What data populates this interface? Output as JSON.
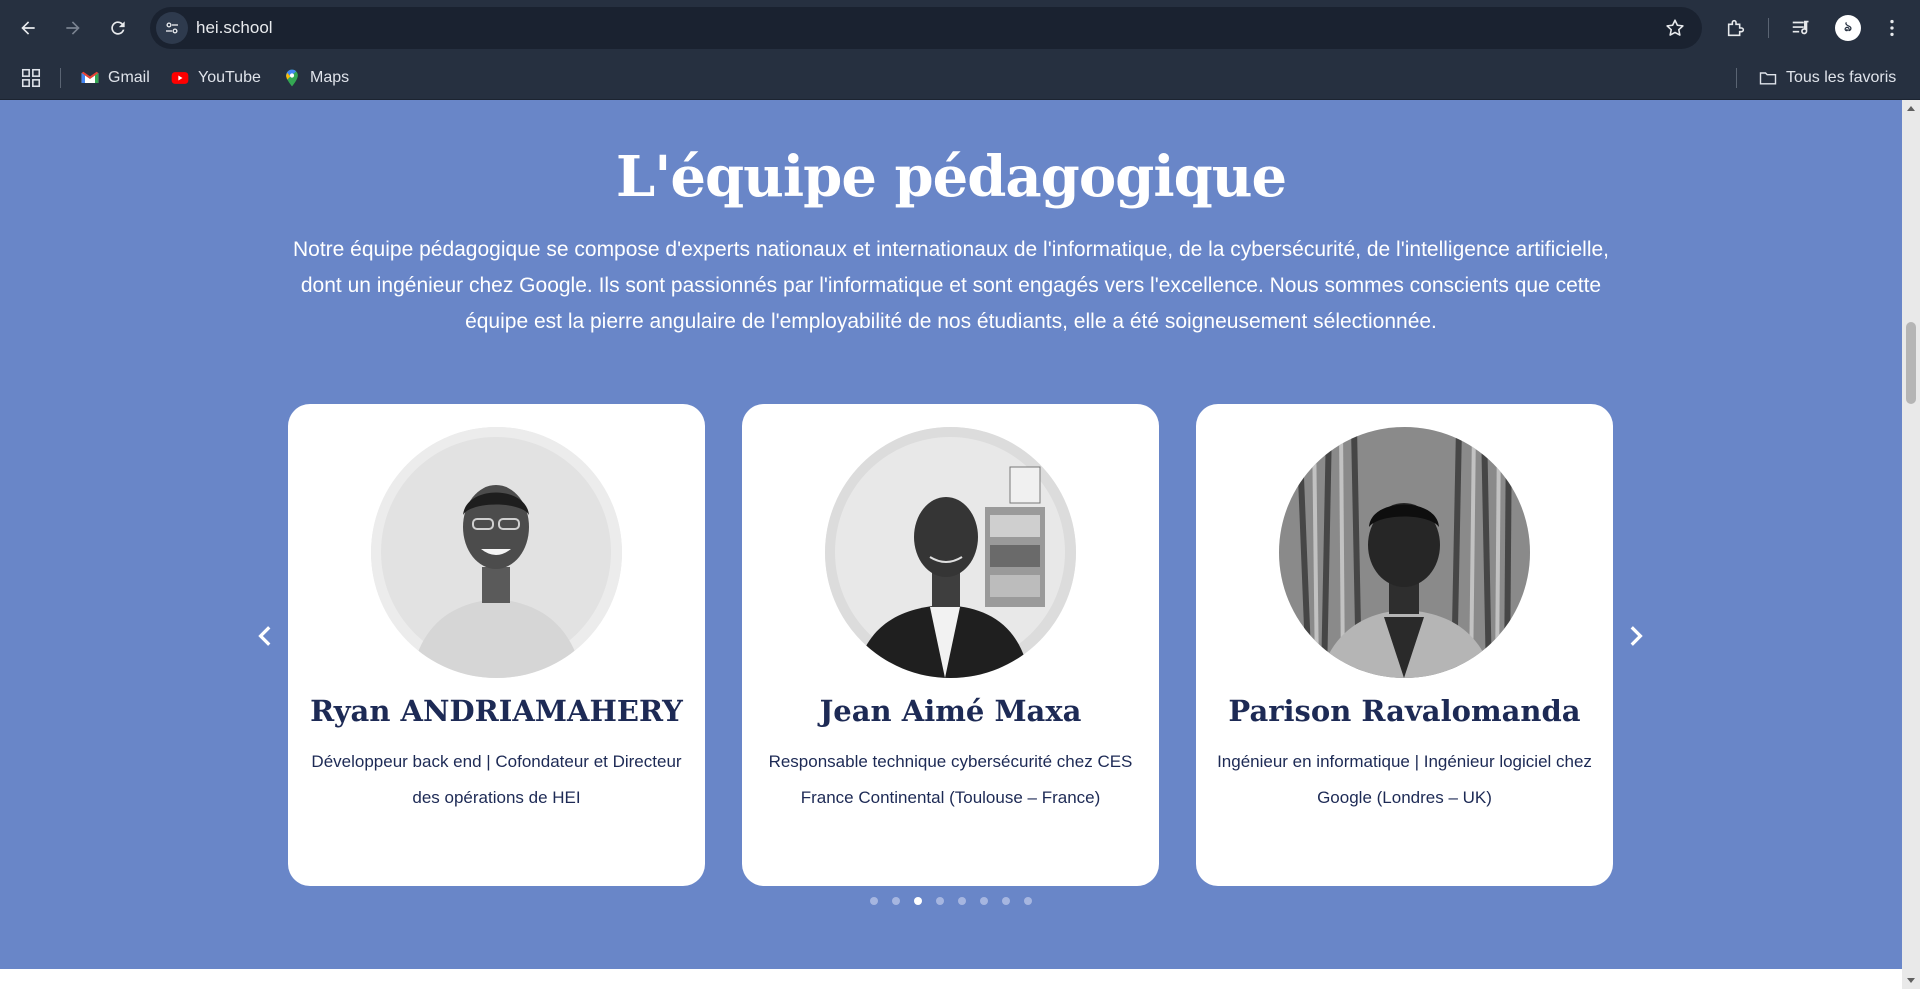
{
  "browser": {
    "url": "hei.school",
    "profile_initial": "ঌ",
    "bookmarks": [
      {
        "label": "Gmail",
        "icon": "gmail-icon"
      },
      {
        "label": "YouTube",
        "icon": "youtube-icon"
      },
      {
        "label": "Maps",
        "icon": "maps-icon"
      }
    ],
    "all_bookmarks_label": "Tous les favoris"
  },
  "team_section": {
    "title": "L'équipe pédagogique",
    "description": "Notre équipe pédagogique se compose d'experts nationaux et internationaux de l'informatique, de la cybersécurité, de l'intelligence artificielle, dont un ingénieur chez Google. Ils sont passionnés par l'informatique et sont engagés vers l'excellence. Nous sommes conscients que cette équipe est la pierre angulaire de l'employabilité de nos étudiants, elle a été soigneusement sélectionnée.",
    "members": [
      {
        "name": "Ryan ANDRIAMAHERY",
        "role": "Développeur back end | Cofondateur et Directeur des opérations de HEI"
      },
      {
        "name": "Jean Aimé Maxa",
        "role": "Responsable technique cybersécurité chez CES France Continental (Toulouse – France)"
      },
      {
        "name": "Parison Ravalomanda",
        "role": "Ingénieur en informatique |  Ingénieur logiciel chez Google (Londres – UK)"
      }
    ],
    "carousel": {
      "dot_count": 8,
      "active_index": 2
    }
  },
  "colors": {
    "section_background": "#6986c8",
    "card_background": "#ffffff",
    "name_text": "#1d2a55",
    "browser_chrome": "#263040"
  }
}
